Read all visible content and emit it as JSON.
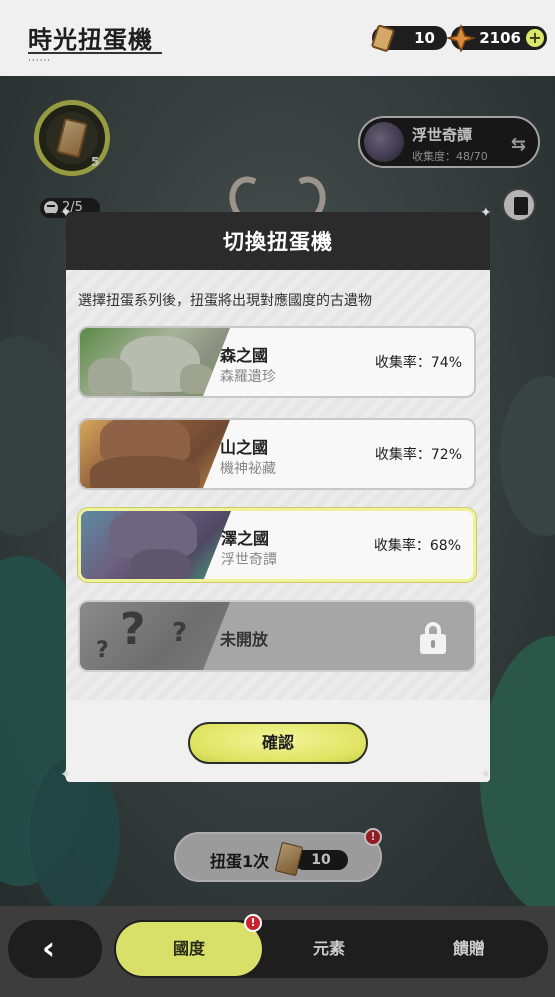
{
  "header": {
    "title": "時光扭蛋機",
    "tickets": "10",
    "stars": "2106"
  },
  "scene": {
    "book_count": "5",
    "page_indicator": "2/5",
    "current_series": {
      "name": "浮世奇譚",
      "rate_label": "收集度：48/70"
    },
    "pull_button": {
      "label": "扭蛋1次",
      "cost": "10"
    }
  },
  "modal": {
    "title": "切換扭蛋機",
    "subtitle": "選擇扭蛋系列後，扭蛋將出現對應國度的古遺物",
    "options": [
      {
        "name": "森之國",
        "sub": "森羅遺珍",
        "rate": "收集率：74%"
      },
      {
        "name": "山之國",
        "sub": "機神祕藏",
        "rate": "收集率：72%"
      },
      {
        "name": "澤之國",
        "sub": "浮世奇譚",
        "rate": "收集率：68%"
      },
      {
        "name": "未開放",
        "sub": "",
        "rate": ""
      }
    ],
    "confirm_label": "確認"
  },
  "bottom_nav": {
    "back_icon": "‹",
    "tabs": [
      {
        "label": "國度"
      },
      {
        "label": "元素"
      },
      {
        "label": "饋贈"
      }
    ],
    "alert": "!"
  },
  "colors": {
    "accent": "#d8e06a",
    "alert": "#c8232e",
    "header_bg": "#2b2b2b"
  }
}
